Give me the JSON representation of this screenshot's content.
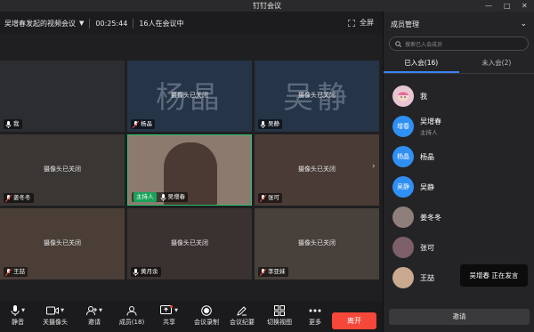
{
  "window": {
    "title": "钉钉会议",
    "minimize": "—",
    "maximize": "□",
    "close": "✕"
  },
  "info": {
    "meeting_name": "吴增春发起的视频会议",
    "duration": "00:25:44",
    "in_meeting": "16人在会议中",
    "fullscreen_label": "全屏"
  },
  "camera_off_label": "摄像头已关闭",
  "tiles": [
    {
      "name": "我",
      "camera_off": false,
      "big_name": "",
      "host": false,
      "muted": false
    },
    {
      "name": "杨晶",
      "camera_off": true,
      "big_name": "杨晶",
      "host": false,
      "muted": true
    },
    {
      "name": "吴静",
      "camera_off": true,
      "big_name": "吴静",
      "host": false,
      "muted": false
    },
    {
      "name": "姜冬冬",
      "camera_off": true,
      "big_name": "",
      "host": false,
      "muted": true
    },
    {
      "name": "吴增春",
      "camera_off": false,
      "big_name": "",
      "host": true,
      "host_label": "主持人",
      "muted": false
    },
    {
      "name": "张可",
      "camera_off": true,
      "big_name": "",
      "host": false,
      "muted": true
    },
    {
      "name": "王喆",
      "camera_off": true,
      "big_name": "",
      "host": false,
      "muted": true
    },
    {
      "name": "黄月余",
      "camera_off": true,
      "big_name": "",
      "host": false,
      "muted": false
    },
    {
      "name": "李亚妹",
      "camera_off": true,
      "big_name": "",
      "host": false,
      "muted": true
    }
  ],
  "toolbar": {
    "mute": "静音",
    "camera": "关摄像头",
    "invite": "邀请",
    "members": "成员(18)",
    "share": "共享",
    "record": "会议录制",
    "minutes": "会议纪要",
    "switch_view": "切换视图",
    "more": "更多",
    "leave": "离开"
  },
  "panel": {
    "title": "成员管理",
    "search_placeholder": "搜索已入会成员",
    "tab_joined": "已入会(16)",
    "tab_not_joined": "未入会(2)",
    "members": [
      {
        "name": "我",
        "role": "",
        "avatar_text": "",
        "avatar_color": "#e7c6d3"
      },
      {
        "name": "吴增春",
        "role": "主持人",
        "avatar_text": "增春",
        "avatar_color": "#2f8ff3"
      },
      {
        "name": "杨晶",
        "role": "",
        "avatar_text": "杨晶",
        "avatar_color": "#2f8ff3"
      },
      {
        "name": "吴静",
        "role": "",
        "avatar_text": "吴静",
        "avatar_color": "#2f8ff3"
      },
      {
        "name": "姜冬冬",
        "role": "",
        "avatar_text": "",
        "avatar_color": "#8f7f7a"
      },
      {
        "name": "张可",
        "role": "",
        "avatar_text": "",
        "avatar_color": "#7d5f6a"
      },
      {
        "name": "王喆",
        "role": "",
        "avatar_text": "",
        "avatar_color": "#c9a98f"
      }
    ],
    "invite_label": "邀请"
  },
  "speaking": "吴增春  正在发言"
}
